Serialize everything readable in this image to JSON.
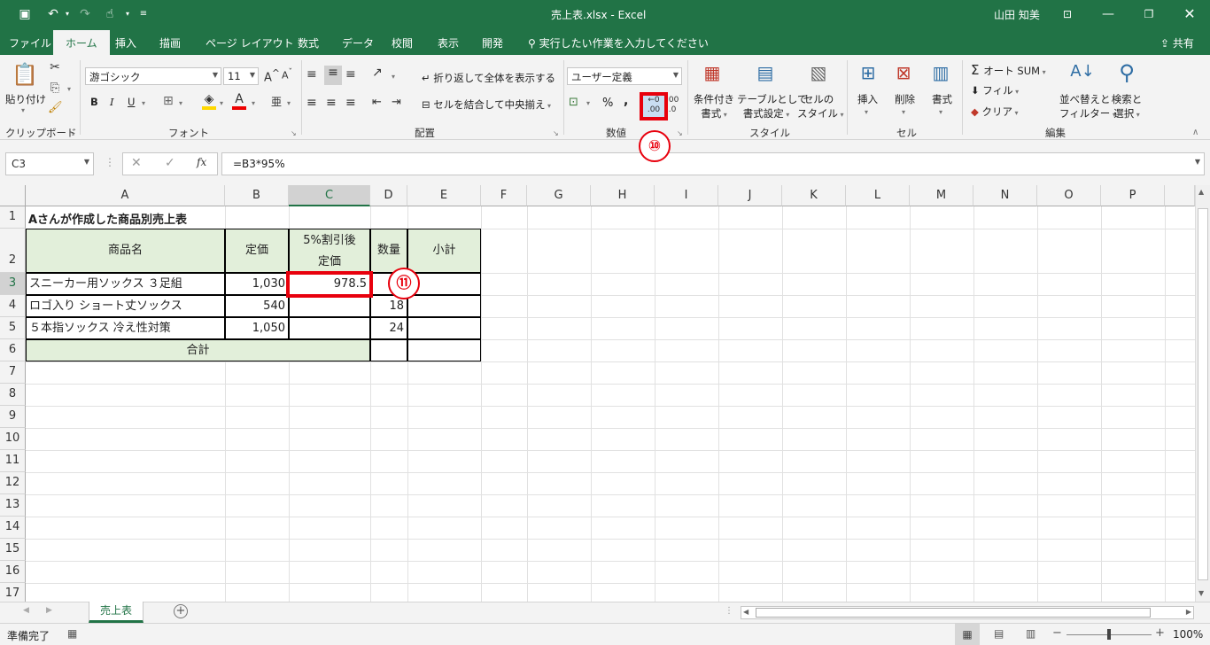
{
  "window": {
    "title": "売上表.xlsx - Excel",
    "user": "山田 知美"
  },
  "tabs": [
    "ファイル",
    "ホーム",
    "挿入",
    "描画",
    "ページ レイアウト",
    "数式",
    "データ",
    "校閲",
    "表示",
    "開発"
  ],
  "tell_me": "実行したい作業を入力してください",
  "share": "共有",
  "ribbon": {
    "clipboard": {
      "paste": "貼り付け",
      "group": "クリップボード"
    },
    "font": {
      "name": "游ゴシック",
      "size": "11",
      "group": "フォント",
      "bold": "B",
      "italic": "I",
      "underline": "U"
    },
    "alignment": {
      "wrap": "折り返して全体を表示する",
      "merge": "セルを結合して中央揃え",
      "group": "配置"
    },
    "number": {
      "format": "ユーザー定義",
      "percent": "%",
      "comma": ",",
      "group": "数値"
    },
    "styles": {
      "conditional_1": "条件付き",
      "conditional_2": "書式",
      "table_1": "テーブルとして",
      "table_2": "書式設定",
      "cell_1": "セルの",
      "cell_2": "スタイル",
      "group": "スタイル"
    },
    "cells": {
      "insert": "挿入",
      "delete": "削除",
      "format": "書式",
      "group": "セル"
    },
    "editing": {
      "autosum": "オート SUM",
      "fill": "フィル",
      "clear": "クリア",
      "sort_1": "並べ替えと",
      "sort_2": "フィルター",
      "find_1": "検索と",
      "find_2": "選択",
      "group": "編集"
    }
  },
  "formula_bar": {
    "name_box": "C3",
    "formula": "=B3*95%"
  },
  "columns": [
    "A",
    "B",
    "C",
    "D",
    "E",
    "F",
    "G",
    "H",
    "I",
    "J",
    "K",
    "L",
    "M",
    "N",
    "O",
    "P"
  ],
  "rows": [
    "1",
    "2",
    "3",
    "4",
    "5",
    "6",
    "7",
    "8",
    "9",
    "10",
    "11",
    "12",
    "13",
    "14",
    "15",
    "16",
    "17"
  ],
  "sheet": {
    "title": "Aさんが作成した商品別売上表",
    "headers": {
      "name": "商品名",
      "price": "定価",
      "discount_1": "5%割引後",
      "discount_2": "定価",
      "qty": "数量",
      "subtotal": "小計"
    },
    "items": [
      {
        "name": "スニーカー用ソックス ３足組",
        "price": "1,030",
        "discount": "978.5",
        "qty": "",
        "subtotal": ""
      },
      {
        "name": "ロゴ入り ショート丈ソックス",
        "price": "540",
        "discount": "",
        "qty": "18",
        "subtotal": ""
      },
      {
        "name": "５本指ソックス 冷え性対策",
        "price": "1,050",
        "discount": "",
        "qty": "24",
        "subtotal": ""
      }
    ],
    "total": "合計"
  },
  "sheet_tab": "売上表",
  "status": {
    "ready": "準備完了",
    "zoom": "100%"
  },
  "callouts": {
    "step10": "⑩",
    "step11": "⑪"
  },
  "accent_color": "#217346",
  "highlight_color": "#e8000d"
}
